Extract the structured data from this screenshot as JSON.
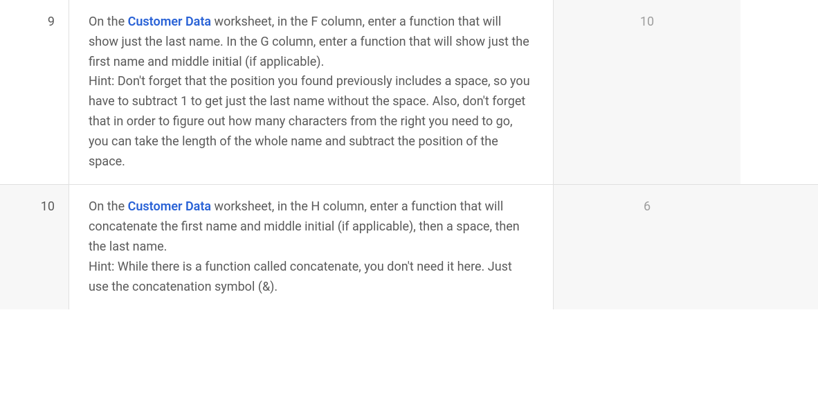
{
  "rows": [
    {
      "number": "9",
      "prefix": "On the ",
      "link": "Customer Data",
      "rest": " worksheet, in the F column, enter a function that will show just the last name. In the G column, enter a function that will show just the first name and middle initial (if applicable).",
      "hint": "Hint: Don't forget that the position you found previously includes a space, so you have to subtract 1 to get just the last name without the space. Also, don't forget that in order to figure out how many characters from the right you need to go, you can take the length of the whole name and subtract the position of the space.",
      "score": "10"
    },
    {
      "number": "10",
      "prefix": "On the ",
      "link": "Customer Data",
      "rest": " worksheet, in the H column, enter a function that will concatenate the first name and middle initial (if applicable), then a space, then the last name.",
      "hint": "Hint: While there is a function called concatenate, you don't need it here.  Just use the concatenation symbol (&).",
      "score": "6"
    }
  ]
}
